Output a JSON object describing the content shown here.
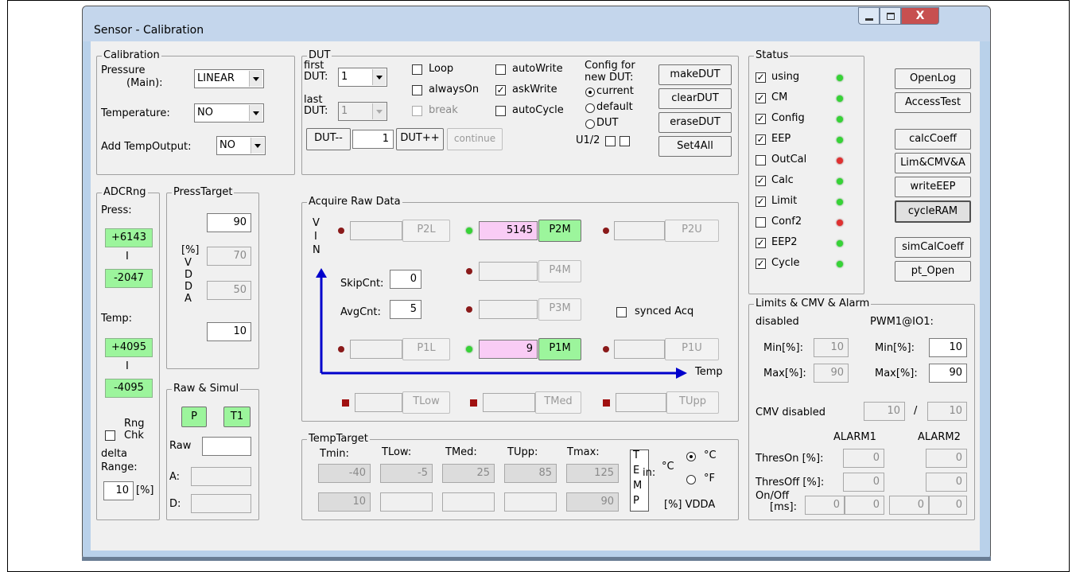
{
  "window": {
    "title": "Sensor - Calibration",
    "min_icon": "minimize-icon",
    "max_icon": "maximize-icon",
    "close_label": "X"
  },
  "calibration": {
    "title": "Calibration",
    "pressure_label": "Pressure",
    "pressure_label2": "(Main):",
    "pressure_value": "LINEAR",
    "temperature_label": "Temperature:",
    "temperature_value": "NO",
    "addtemp_label": "Add TempOutput:",
    "addtemp_value": "NO"
  },
  "dut": {
    "title": "DUT",
    "first_label": "first",
    "first_label2": "DUT:",
    "first_value": "1",
    "last_label": "last",
    "last_label2": "DUT:",
    "last_value": "1",
    "loop": "Loop",
    "alwayson": "alwaysOn",
    "break": "break",
    "autowrite": "autoWrite",
    "askwrite": "askWrite",
    "autocycle": "autoCycle",
    "config_for": "Config for",
    "new_dut": "new DUT:",
    "current": "current",
    "default": "default",
    "dut_radio": "DUT",
    "u12": "U1/2",
    "dut_minus": "DUT--",
    "dut_value": "1",
    "dut_plus": "DUT++",
    "continue": "continue",
    "makedut": "makeDUT",
    "cleardut": "clearDUT",
    "erasedut": "eraseDUT",
    "set4all": "Set4All"
  },
  "status": {
    "title": "Status",
    "items": [
      {
        "label": "using",
        "checked": true,
        "led": "green"
      },
      {
        "label": "CM",
        "checked": true,
        "led": "green"
      },
      {
        "label": "Config",
        "checked": true,
        "led": "green"
      },
      {
        "label": "EEP",
        "checked": true,
        "led": "green"
      },
      {
        "label": "OutCal",
        "checked": false,
        "led": "red"
      },
      {
        "label": "Calc",
        "checked": true,
        "led": "green"
      },
      {
        "label": "Limit",
        "checked": true,
        "led": "green"
      },
      {
        "label": "Conf2",
        "checked": false,
        "led": "red"
      },
      {
        "label": "EEP2",
        "checked": true,
        "led": "green"
      },
      {
        "label": "Cycle",
        "checked": true,
        "led": "green"
      }
    ]
  },
  "side_buttons": {
    "openlog": "OpenLog",
    "accesstest": "AccessTest",
    "calccoeff": "calcCoeff",
    "limcmv": "Lim&CMV&A",
    "writeeep": "writeEEP",
    "cycleram": "cycleRAM",
    "simcalcoeff": "simCalCoeff",
    "ptopen": "pt_Open"
  },
  "adcrng": {
    "title": "ADCRng",
    "press_label": "Press:",
    "press_max": "+6143",
    "press_sep": "I",
    "press_min": "-2047",
    "temp_label": "Temp:",
    "temp_max": "+4095",
    "temp_sep": "I",
    "temp_min": "-4095",
    "rng_label": "Rng",
    "chk_label": "Chk",
    "delta_label": "delta",
    "range_label": "Range:",
    "range_value": "10",
    "range_unit": "[%]"
  },
  "presstarget": {
    "title": "PressTarget",
    "v1": "90",
    "v2": "70",
    "v3": "50",
    "v4": "10",
    "unit": "[%]",
    "vdda": [
      "V",
      "D",
      "D",
      "A"
    ]
  },
  "rawsimul": {
    "title": "Raw & Simul",
    "p_btn": "P",
    "t1_btn": "T1",
    "raw_label": "Raw",
    "raw_value": "",
    "a_label": "A:",
    "d_label": "D:"
  },
  "acquire": {
    "title": "Acquire Raw Data",
    "vin": [
      "V",
      "I",
      "N"
    ],
    "p2l": "P2L",
    "p2m": "P2M",
    "p2m_value": "5145",
    "p2u": "P2U",
    "p4m": "P4M",
    "p3m": "P3M",
    "p1l": "P1L",
    "p1m": "P1M",
    "p1m_value": "9",
    "p1u": "P1U",
    "skipcnt_label": "SkipCnt:",
    "skipcnt_value": "0",
    "avgcnt_label": "AvgCnt:",
    "avgcnt_value": "5",
    "synced": "synced Acq",
    "temp_axis": "Temp",
    "tlow": "TLow",
    "tmed": "TMed",
    "tupp": "TUpp"
  },
  "temptarget": {
    "title": "TempTarget",
    "tmin": "Tmin:",
    "tlow": "TLow:",
    "tmed": "TMed:",
    "tupp": "TUpp:",
    "tmax": "Tmax:",
    "row1": [
      "-40",
      "-5",
      "25",
      "85",
      "125"
    ],
    "row2": [
      "10",
      "",
      "",
      "",
      "90"
    ],
    "temp_vert": [
      "T",
      "E",
      "M",
      "P"
    ],
    "in_label": "in:",
    "unit_c": "°C",
    "opt_c": "°C",
    "opt_f": "°F",
    "vdda": "[%] VDDA"
  },
  "limits": {
    "title": "Limits & CMV & Alarm",
    "disabled": "disabled",
    "pwm": "PWM1@IO1:",
    "min_label": "Min[%]:",
    "min_dis": "10",
    "min_val": "10",
    "max_label": "Max[%]:",
    "max_dis": "90",
    "max_val": "90",
    "cmv_label": "CMV disabled",
    "cmv_a": "10",
    "cmv_sep": "/",
    "cmv_b": "10",
    "alarm1": "ALARM1",
    "alarm2": "ALARM2",
    "threson_label": "ThresOn [%]:",
    "threson1": "0",
    "threson2": "0",
    "thresoff_label": "ThresOff [%]:",
    "thresoff1": "0",
    "thresoff2": "0",
    "onoff_label": "On/Off",
    "ms_label": "[ms]:",
    "onoff": [
      "0",
      "0",
      "0",
      "0"
    ]
  },
  "colors": {
    "green_led": "#36d336",
    "red_led": "#e03030",
    "highlight_yellow": "#ffff3c",
    "highlight_cyan": "#55e5ee",
    "highlight_green": "#9cf59c",
    "pink_field": "#f9ccf5",
    "axis_blue": "#0000cc"
  }
}
